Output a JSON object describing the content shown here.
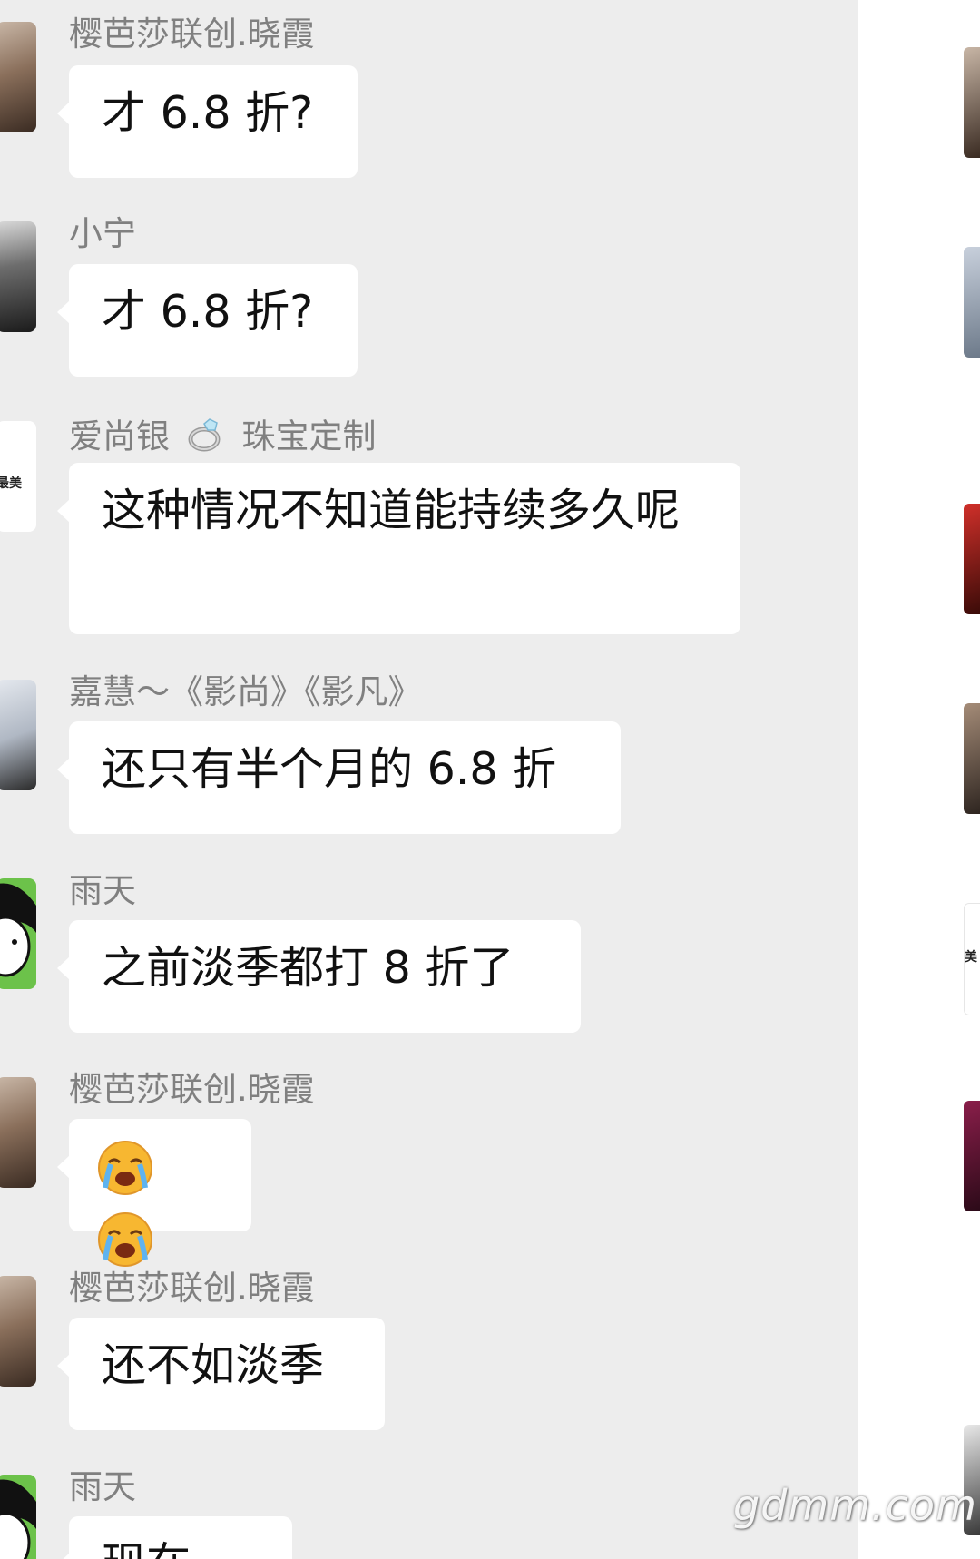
{
  "messages": [
    {
      "sender": "樱芭莎联创.晓霞",
      "text": "才 6.8 折?"
    },
    {
      "sender": "小宁",
      "text": "才 6.8 折?"
    },
    {
      "sender_prefix": "爱尚银",
      "sender_icon": "ring-icon",
      "sender_suffix": "珠宝定制",
      "text": "这种情况不知道能持续多久呢",
      "avatar_text": "最美"
    },
    {
      "sender": "嘉慧～《影尚》《影凡》",
      "text": "还只有半个月的 6.8 折"
    },
    {
      "sender": "雨天",
      "text": "之前淡季都打 8 折了"
    },
    {
      "sender": "樱芭莎联创.晓霞",
      "emoji": "loudly-crying-face-icon"
    },
    {
      "sender": "樱芭莎联创.晓霞",
      "text": "还不如淡季"
    },
    {
      "sender": "雨天",
      "text": "现在"
    }
  ],
  "right_strip": {
    "avatar_text": "美"
  },
  "watermark": "gdmm.com",
  "colors": {
    "chat_bg": "#ededed",
    "bubble_bg": "#ffffff",
    "name_text": "#808080",
    "message_text": "#111111"
  }
}
